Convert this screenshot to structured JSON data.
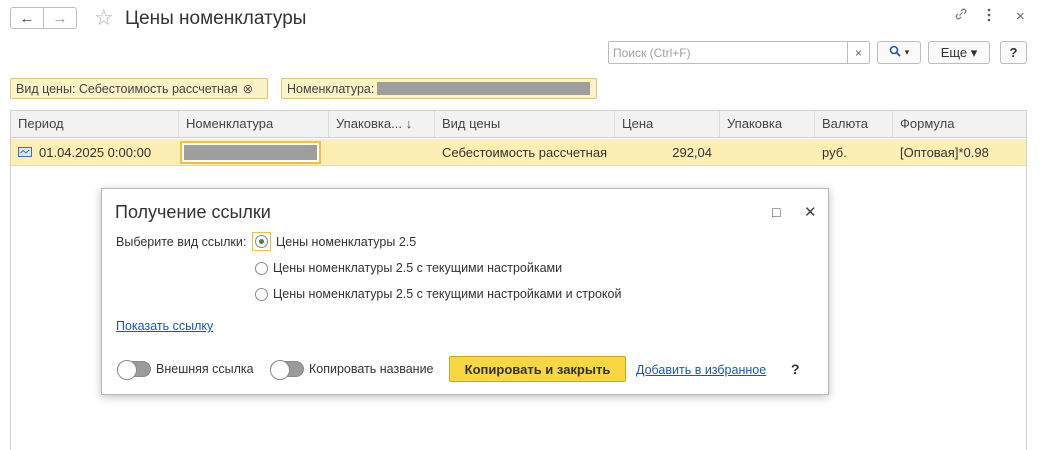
{
  "window": {
    "title": "Цены номенклатуры",
    "back_icon": "←",
    "forward_icon": "→",
    "star_icon": "☆",
    "link_icon": "🔗",
    "more_icon": "⋮",
    "close_icon": "×"
  },
  "toolbar": {
    "search_placeholder": "Поиск (Ctrl+F)",
    "search_clear": "×",
    "search_button": "🔍 ▾",
    "more_button": "Еще ▾",
    "help_button": "?"
  },
  "filters": {
    "price_type": "Вид цены: Себестоимость рассчетная",
    "price_type_clear": "⊗",
    "nomenclature_label": "Номенклатура:"
  },
  "table": {
    "columns": [
      "Период",
      "Номенклатура",
      "Упаковка... ↓",
      "Вид цены",
      "Цена",
      "Упаковка",
      "Валюта",
      "Формула"
    ],
    "rows": [
      {
        "period": "01.04.2025 0:00:00",
        "nomenclature": "",
        "packaging_sort": "",
        "price_type": "Себестоимость рассчетная",
        "price": "292,04",
        "packaging": "",
        "currency": "руб.",
        "formula": "[Оптовая]*0.98"
      }
    ]
  },
  "dialog": {
    "title": "Получение ссылки",
    "maximize_icon": "□",
    "close_icon": "✕",
    "choose_label": "Выберите вид ссылки:",
    "options": [
      "Цены номенклатуры 2.5",
      "Цены номенклатуры 2.5 с текущими настройками",
      "Цены номенклатуры 2.5 с текущими настройками и строкой"
    ],
    "selected_option": 0,
    "show_link": "Показать ссылку",
    "external_link_toggle": "Внешняя ссылка",
    "copy_name_toggle": "Копировать название",
    "copy_close_button": "Копировать и закрыть",
    "add_favorites": "Добавить в избранное",
    "help": "?"
  },
  "colors": {
    "highlight_row": "#fcefb4",
    "filter_bg": "#fbf2c7",
    "primary_button": "#f7d843",
    "link": "#1a56b8"
  }
}
